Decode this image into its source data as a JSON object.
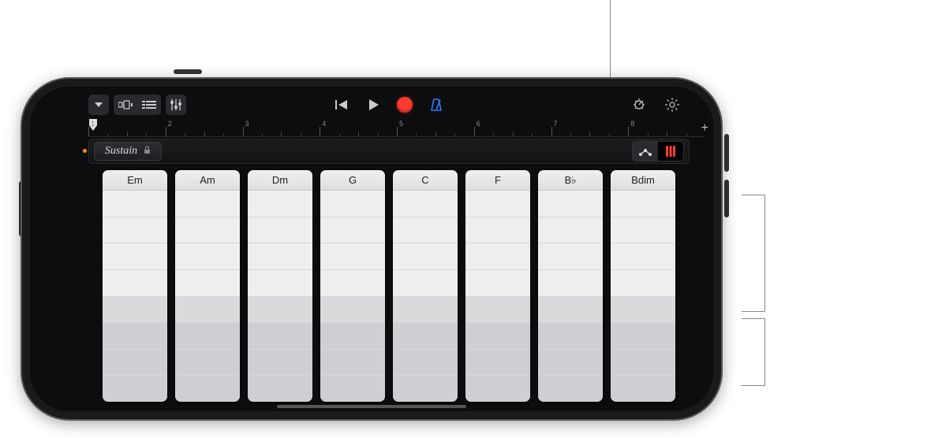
{
  "toolbar": {
    "dropdown_icon": "chevron-down",
    "view_tracks_icon": "tracks-icon",
    "view_grid_icon": "grid-icon",
    "mixer_icon": "sliders-icon",
    "rewind_icon": "skip-back-icon",
    "play_icon": "play-icon",
    "record_icon": "record-icon",
    "metronome_icon": "metronome-icon",
    "metronome_color": "#2e7cff",
    "controls_icon": "knob-icon",
    "settings_icon": "gear-icon"
  },
  "ruler": {
    "bars": [
      "1",
      "2",
      "3",
      "4",
      "5",
      "6",
      "7",
      "8"
    ],
    "add_label": "+"
  },
  "subbar": {
    "sustain_label": "Sustain",
    "lock_icon": "lock-icon",
    "autoplay_icon": "autoplay-icon",
    "strips_icon": "chord-strips-icon",
    "strips_active_color": "#ff3b30"
  },
  "chords": [
    "Em",
    "Am",
    "Dm",
    "G",
    "C",
    "F",
    "B♭",
    "Bdim"
  ],
  "strip_segments": {
    "light_count": 4,
    "mid_count": 1,
    "dark_count": 3
  },
  "colors": {
    "record": "#ff3b30",
    "accent_blue": "#2e7cff",
    "accent_orange": "#ff9500"
  }
}
